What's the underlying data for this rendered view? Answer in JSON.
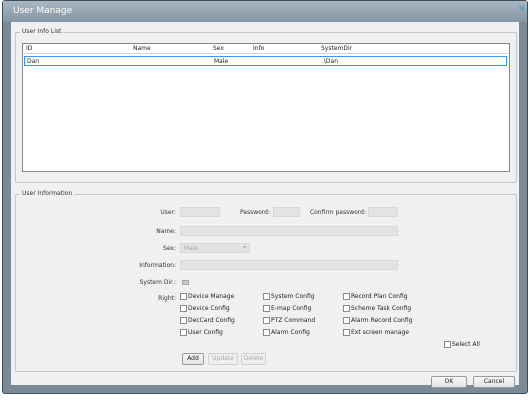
{
  "window": {
    "title": "User Manage"
  },
  "user_info_list": {
    "group_label": "User Info List",
    "columns": [
      "ID",
      "Name",
      "Sex",
      "Info",
      "SystemDir"
    ],
    "rows": [
      {
        "id": "Dan",
        "name": "",
        "sex": "Male",
        "info": "",
        "system_dir": ".\\Dan"
      }
    ]
  },
  "user_information": {
    "group_label": "User Information",
    "user_label": "User:",
    "user_value": "",
    "password_label": "Password:",
    "confirm_password_label": "Confirm password:",
    "name_label": "Name:",
    "sex_label": "Sex:",
    "sex_value": "Male",
    "information_label": "Information:",
    "system_dir_label": "System Dir.:",
    "right_label": "Right:",
    "rights": [
      {
        "label": "Device Manage",
        "checked": false
      },
      {
        "label": "System Config",
        "checked": false
      },
      {
        "label": "Record Plan Config",
        "checked": false
      },
      {
        "label": "Device Config",
        "checked": false
      },
      {
        "label": "E-map Config",
        "checked": false
      },
      {
        "label": "Scheme Task Config",
        "checked": false
      },
      {
        "label": "DecCard Config",
        "checked": false
      },
      {
        "label": "PTZ Command",
        "checked": false
      },
      {
        "label": "Alarm Record Config",
        "checked": false
      },
      {
        "label": "User Config",
        "checked": false
      },
      {
        "label": "Alarm Config",
        "checked": false
      },
      {
        "label": "Ext screen manage",
        "checked": false
      }
    ],
    "select_all_label": "Select All",
    "add_label": "Add",
    "update_label": "Update",
    "delete_label": "Delete"
  },
  "footer": {
    "ok_label": "OK",
    "cancel_label": "Cancel"
  }
}
